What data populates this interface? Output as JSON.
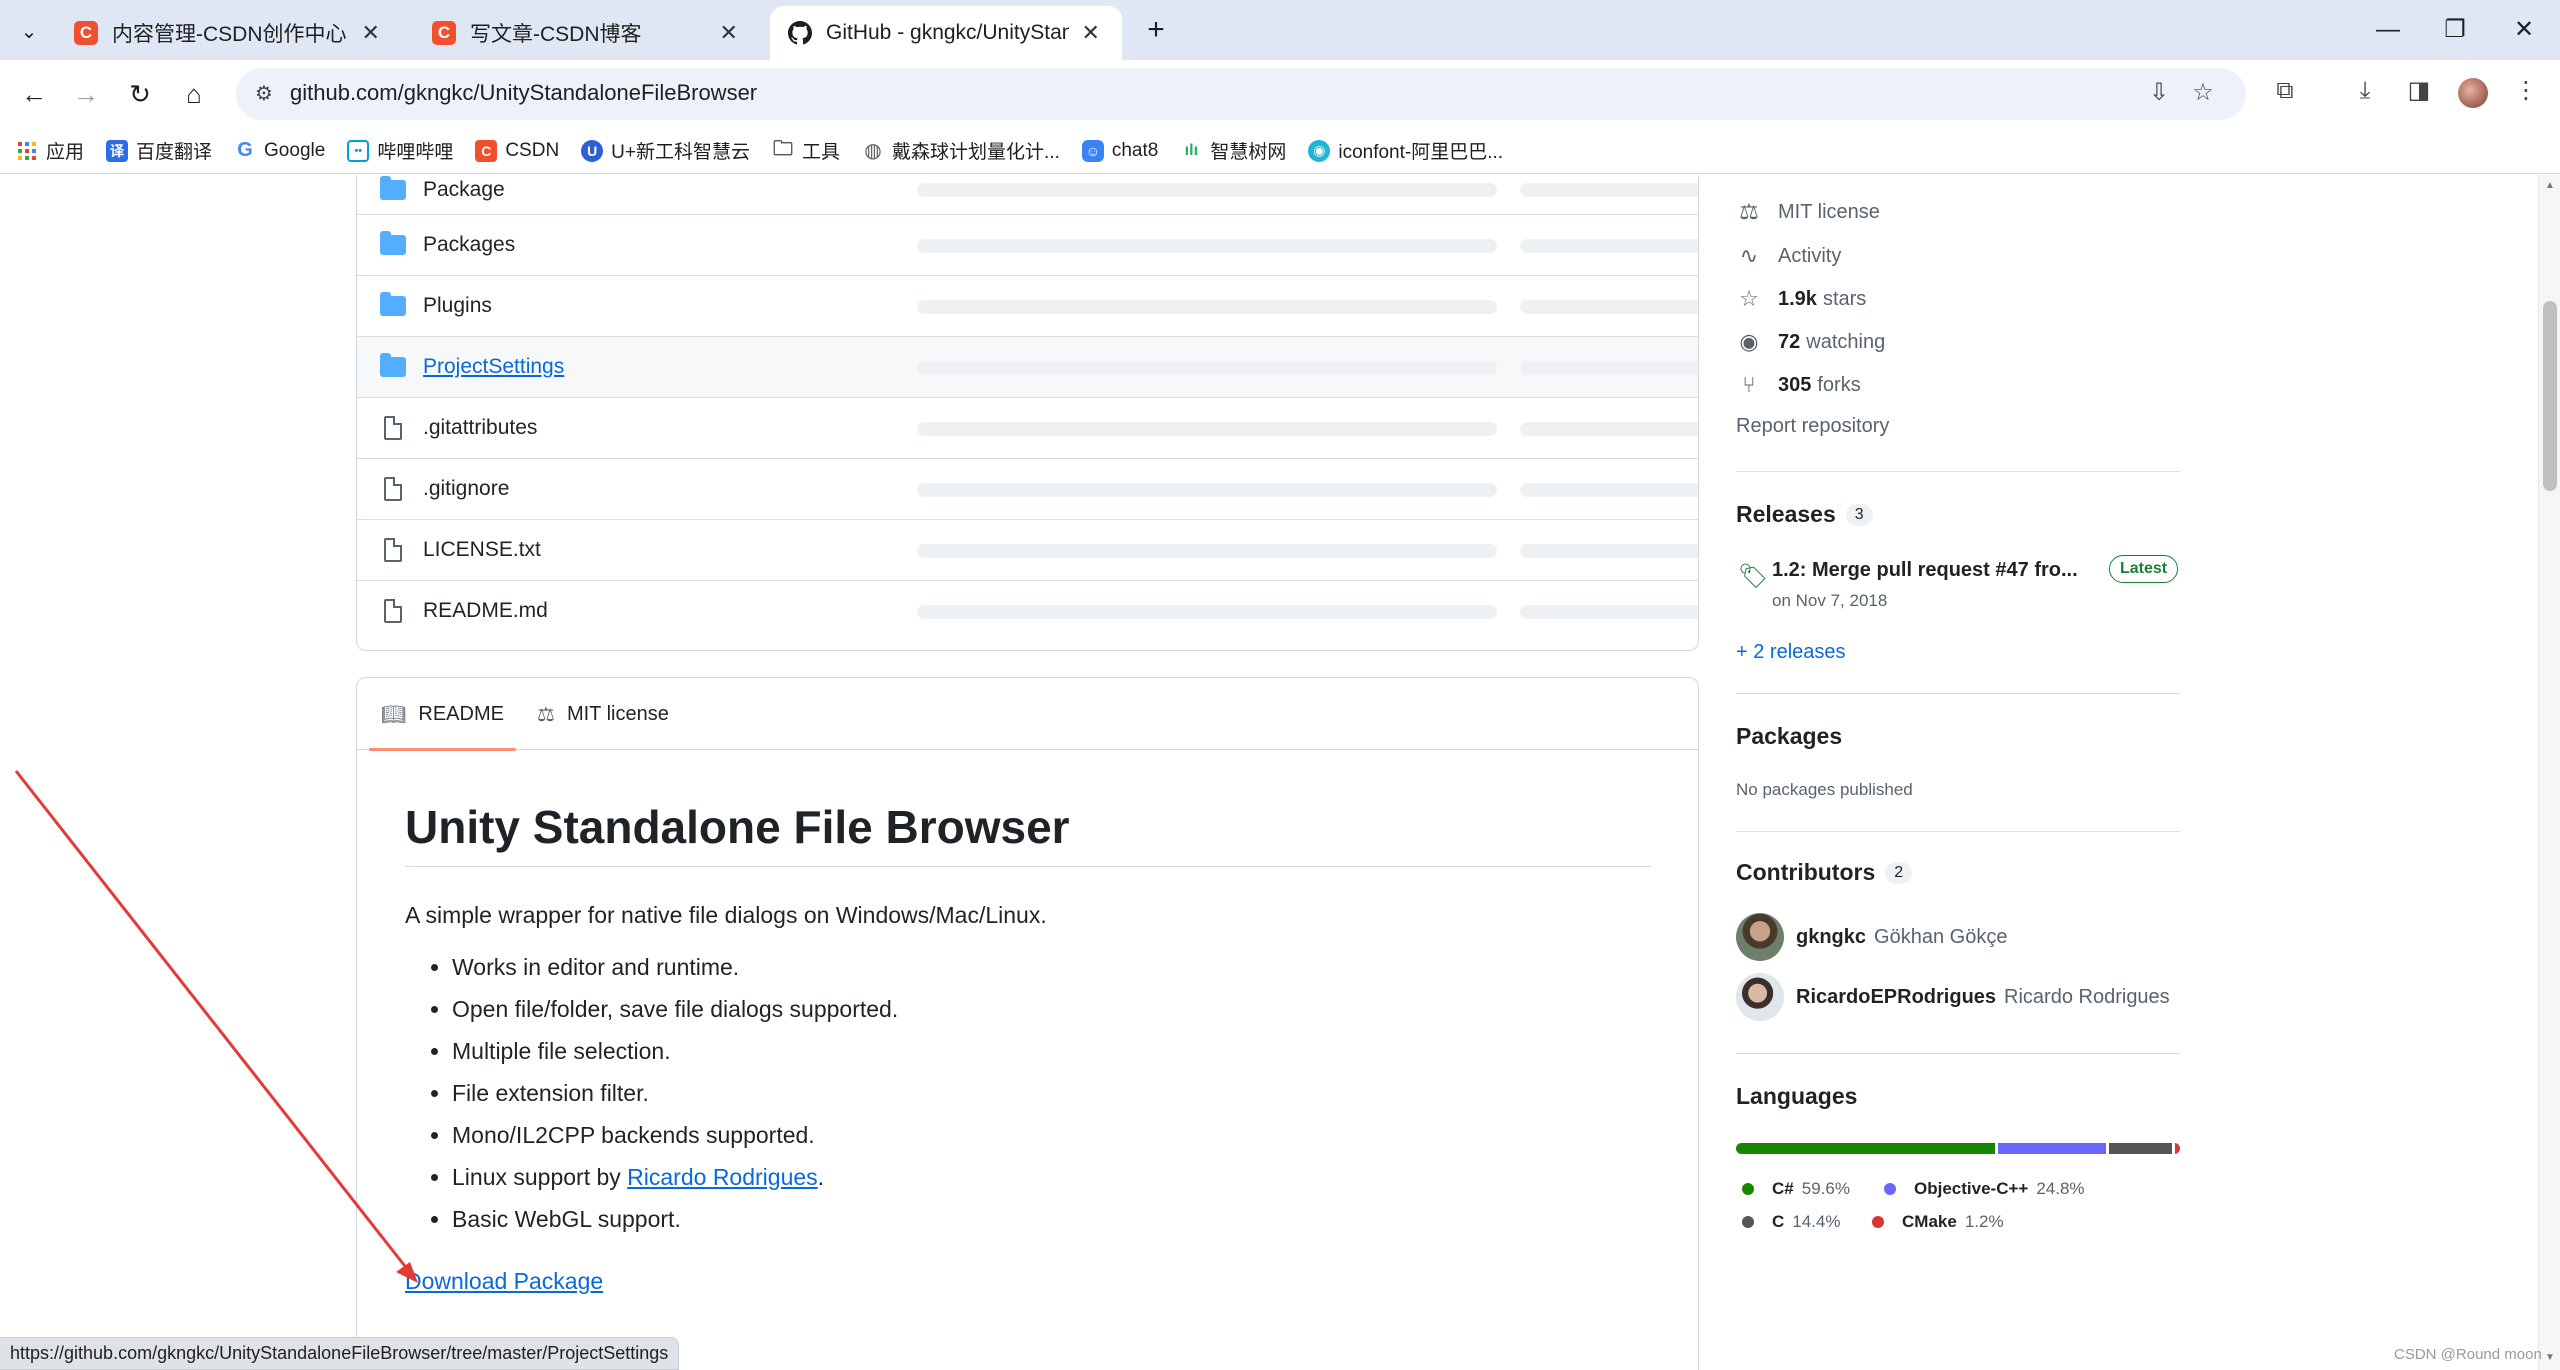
{
  "browser": {
    "tabs": [
      {
        "title": "内容管理-CSDN创作中心",
        "favicon": "C",
        "active": false
      },
      {
        "title": "写文章-CSDN博客",
        "favicon": "C",
        "active": false
      },
      {
        "title": "GitHub - gkngkc/UnityStand",
        "favicon": "github-icon",
        "active": true
      }
    ],
    "new_tab": "+",
    "window_controls": {
      "minimize": "—",
      "restore": "❐",
      "close": "✕"
    },
    "url": "github.com/gkngkc/UnityStandaloneFileBrowser",
    "bookmarks": [
      {
        "label": "应用",
        "icon": "apps-grid-icon"
      },
      {
        "label": "百度翻译",
        "icon": "translate-icon"
      },
      {
        "label": "Google",
        "icon": "google-icon"
      },
      {
        "label": "哔哩哔哩",
        "icon": "bilibili-icon"
      },
      {
        "label": "CSDN",
        "icon": "csdn-icon"
      },
      {
        "label": "U+新工科智慧云",
        "icon": "u-plus-icon"
      },
      {
        "label": "工具",
        "icon": "folder-icon"
      },
      {
        "label": "戴森球计划量化计...",
        "icon": "globe-icon"
      },
      {
        "label": "chat8",
        "icon": "chat-icon"
      },
      {
        "label": "智慧树网",
        "icon": "tree-icon"
      },
      {
        "label": "iconfont-阿里巴巴...",
        "icon": "iconfont-icon"
      }
    ]
  },
  "files": [
    {
      "name": "Package",
      "type": "folder"
    },
    {
      "name": "Packages",
      "type": "folder"
    },
    {
      "name": "Plugins",
      "type": "folder"
    },
    {
      "name": "ProjectSettings",
      "type": "folder"
    },
    {
      "name": ".gitattributes",
      "type": "file"
    },
    {
      "name": ".gitignore",
      "type": "file"
    },
    {
      "name": "LICENSE.txt",
      "type": "file"
    },
    {
      "name": "README.md",
      "type": "file"
    }
  ],
  "readme": {
    "tabs": [
      "README",
      "MIT license"
    ],
    "title": "Unity Standalone File Browser",
    "description": "A simple wrapper for native file dialogs on Windows/Mac/Linux.",
    "features": [
      "Works in editor and runtime.",
      "Open file/folder, save file dialogs supported.",
      "Multiple file selection.",
      "File extension filter.",
      "Mono/IL2CPP backends supported.",
      "Linux support by",
      "Basic WebGL support."
    ],
    "linux_credit_link": "Ricardo Rodrigues",
    "download_link": "Download Package"
  },
  "sidebar": {
    "license": "MIT license",
    "activity": "Activity",
    "stars": {
      "count": "1.9k",
      "label": "stars"
    },
    "watching": {
      "count": "72",
      "label": "watching"
    },
    "forks": {
      "count": "305",
      "label": "forks"
    },
    "report": "Report repository",
    "releases": {
      "heading": "Releases",
      "count": "3",
      "latest_title": "1.2: Merge pull request #47 fro...",
      "latest_badge": "Latest",
      "latest_date": "on Nov 7, 2018",
      "more": "+ 2 releases"
    },
    "packages": {
      "heading": "Packages",
      "note": "No packages published"
    },
    "contributors": {
      "heading": "Contributors",
      "count": "2",
      "people": [
        {
          "login": "gkngkc",
          "name": "Gökhan Gökçe"
        },
        {
          "login": "RicardoEPRodrigues",
          "name": "Ricardo Rodrigues"
        }
      ]
    },
    "languages": {
      "heading": "Languages",
      "items": [
        {
          "name": "C#",
          "percent": "59.6%",
          "value": 59.6,
          "color": "#178600"
        },
        {
          "name": "Objective-C++",
          "percent": "24.8%",
          "value": 24.8,
          "color": "#6866fb"
        },
        {
          "name": "C",
          "percent": "14.4%",
          "value": 14.4,
          "color": "#555555"
        },
        {
          "name": "CMake",
          "percent": "1.2%",
          "value": 1.2,
          "color": "#da3434"
        }
      ]
    }
  },
  "status_url": "https://github.com/gkngkc/UnityStandaloneFileBrowser/tree/master/ProjectSettings",
  "watermark": "CSDN @Round moon",
  "annotation": {
    "color": "#e53935",
    "kind": "red-arrow"
  }
}
